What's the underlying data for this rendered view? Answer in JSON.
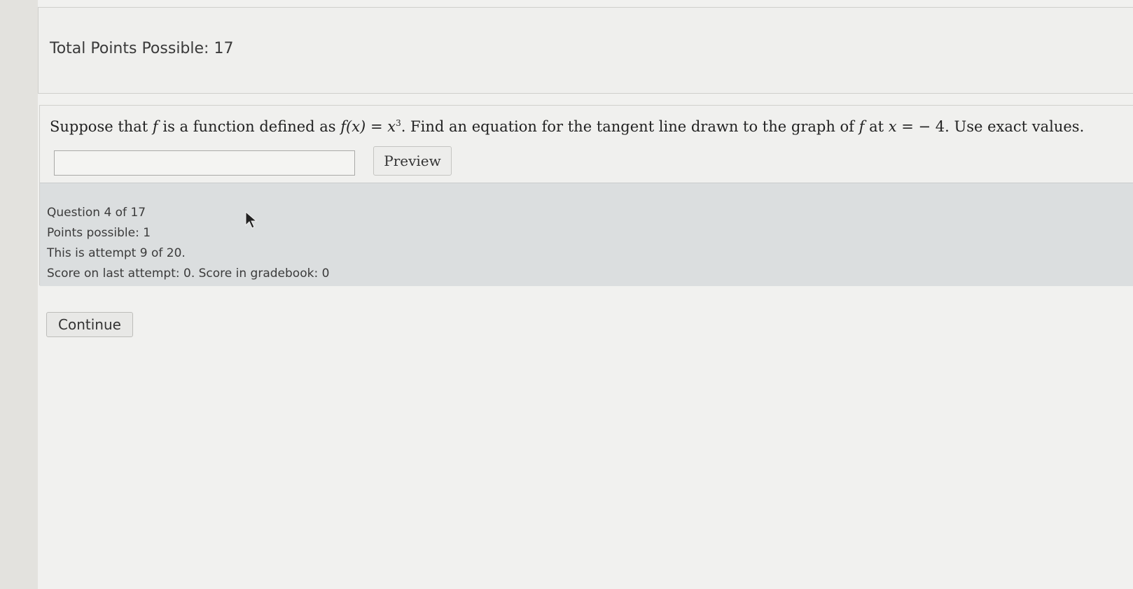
{
  "header": {
    "total_points": "Total Points Possible: 17"
  },
  "question": {
    "text_prefix": "Suppose that ",
    "f1": "f",
    "text_mid1": " is a function defined as ",
    "func_lhs": "f(x)",
    "equals": " = ",
    "func_base": "x",
    "func_exp": "3",
    "text_mid2": ". Find an equation for the tangent line drawn to the graph of ",
    "f2": "f",
    "text_at": " at ",
    "var_x": "x",
    "equals2": " = ",
    "point_value": "− 4",
    "text_suffix": ". Use exact values.",
    "answer_value": "",
    "preview_label": "Preview"
  },
  "info": {
    "question_number": "Question 4 of 17",
    "points_possible": "Points possible: 1",
    "attempt": "This is attempt 9 of 20.",
    "score": "Score on last attempt: 0. Score in gradebook: 0"
  },
  "actions": {
    "continue_label": "Continue"
  },
  "icons": {
    "cursor": "mouse-pointer-icon"
  },
  "colors": {
    "background": "#f1f1ef",
    "info_panel": "#dbdedf",
    "border": "#cfcfcc"
  }
}
